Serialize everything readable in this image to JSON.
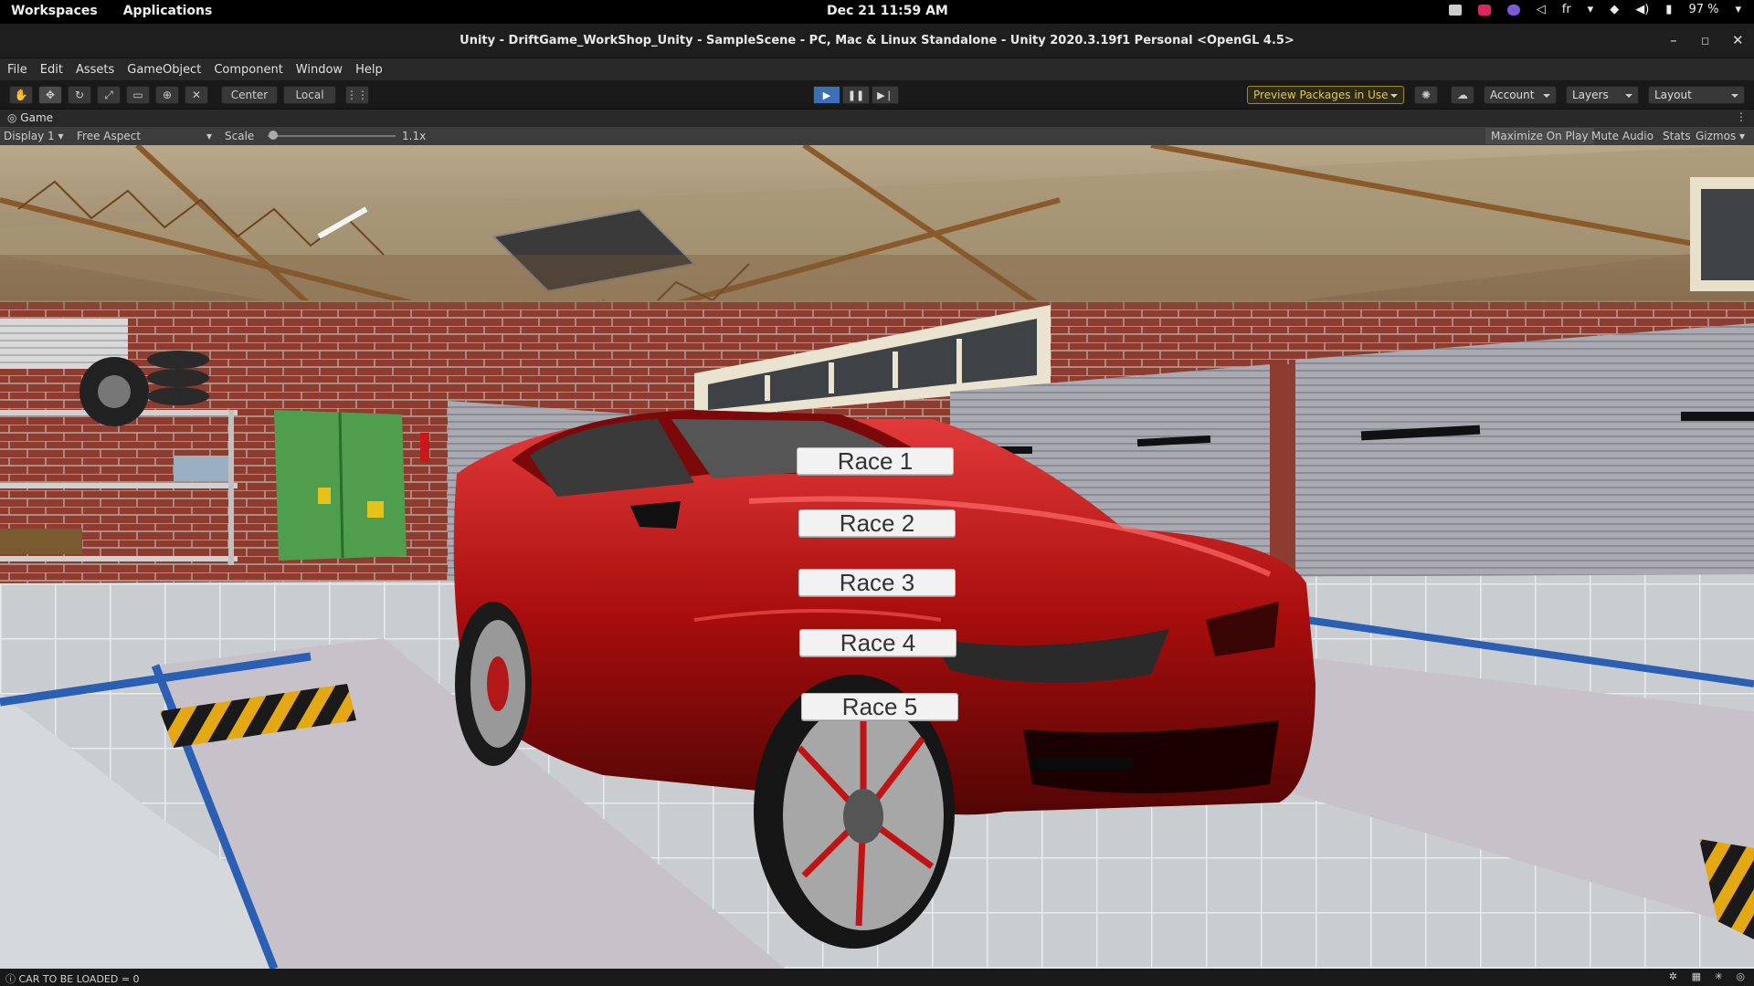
{
  "topbar": {
    "workspaces": "Workspaces",
    "applications": "Applications",
    "datetime": "Dec 21  11:59 AM",
    "keyboard": "fr",
    "battery": "97 %"
  },
  "window": {
    "title": "Unity - DriftGame_WorkShop_Unity - SampleScene - PC, Mac & Linux Standalone - Unity 2020.3.19f1 Personal <OpenGL 4.5>"
  },
  "menu": {
    "items": [
      "File",
      "Edit",
      "Assets",
      "GameObject",
      "Component",
      "Window",
      "Help"
    ]
  },
  "toolbar": {
    "center": "Center",
    "local": "Local",
    "preview_packages": "Preview Packages in Use",
    "account": "Account",
    "layers": "Layers",
    "layout": "Layout"
  },
  "game_view": {
    "tab": "Game",
    "display": "Display 1",
    "aspect": "Free Aspect",
    "scale_label": "Scale",
    "scale_value": "1.1x",
    "maximize": "Maximize On Play",
    "mute": "Mute Audio",
    "stats": "Stats",
    "gizmos": "Gizmos"
  },
  "race_menu": {
    "buttons": [
      "Race 1",
      "Race 2",
      "Race 3",
      "Race 4",
      "Race 5"
    ]
  },
  "status": {
    "message": "CAR TO BE LOADED = 0"
  },
  "colors": {
    "play_active": "#3b6fb6",
    "car_red": "#b10d0d",
    "brick": "#8d3a2e"
  }
}
